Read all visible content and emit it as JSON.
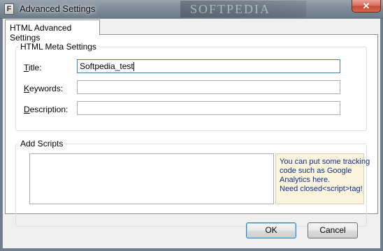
{
  "window": {
    "title": "Advanced Settings",
    "app_icon_letter": "F",
    "close_glyph": "✕",
    "watermark": "SOFTPEDIA"
  },
  "tabs": [
    {
      "label": "HTML Advanced Settings",
      "selected": true
    }
  ],
  "meta_settings": {
    "group_label": "HTML Meta Settings",
    "title_label_key": "T",
    "title_label_rest": "itle:",
    "title_value": "Softpedia_test",
    "keywords_label_key": "K",
    "keywords_label_rest": "eywords:",
    "keywords_value": "",
    "description_label_key": "D",
    "description_label_rest": "escription:",
    "description_value": ""
  },
  "scripts": {
    "group_label": "Add Scripts",
    "value": "",
    "hint_lines": [
      "You can put some tracking",
      "code such as Google",
      "Analytics here.",
      "Need closed<script>tag!"
    ]
  },
  "buttons": {
    "ok_label": "OK",
    "cancel_label": "Cancel"
  },
  "colors": {
    "hint_text": "#10308a",
    "hint_background": "#fcf4dc",
    "focus_border": "#3c7fb1"
  }
}
